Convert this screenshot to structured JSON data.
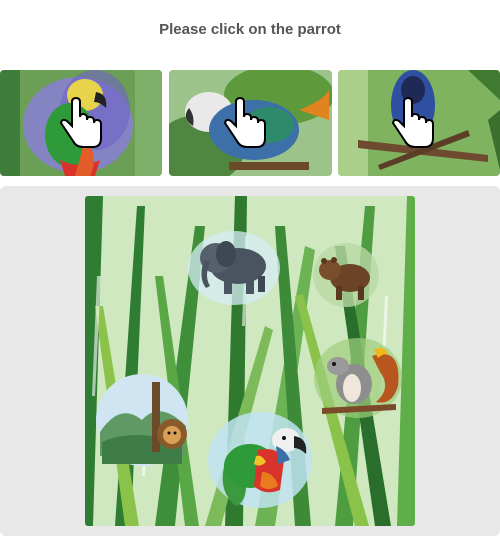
{
  "prompt": "Please click on the parrot",
  "examples": [
    {
      "subject": "parrot",
      "cursor_icon": "hand-pointer-icon"
    },
    {
      "subject": "parrot",
      "cursor_icon": "hand-pointer-icon"
    },
    {
      "subject": "parrot",
      "cursor_icon": "hand-pointer-icon"
    }
  ],
  "canvas": {
    "background": "tall green grass watercolor",
    "animals": [
      "elephant",
      "bear",
      "squirrel",
      "lion",
      "parrot"
    ]
  },
  "colors": {
    "prompt_text": "#555555",
    "panel_bg": "#e8e8e8",
    "grass_dark": "#2e7d32",
    "grass_light": "#8bc34a"
  }
}
